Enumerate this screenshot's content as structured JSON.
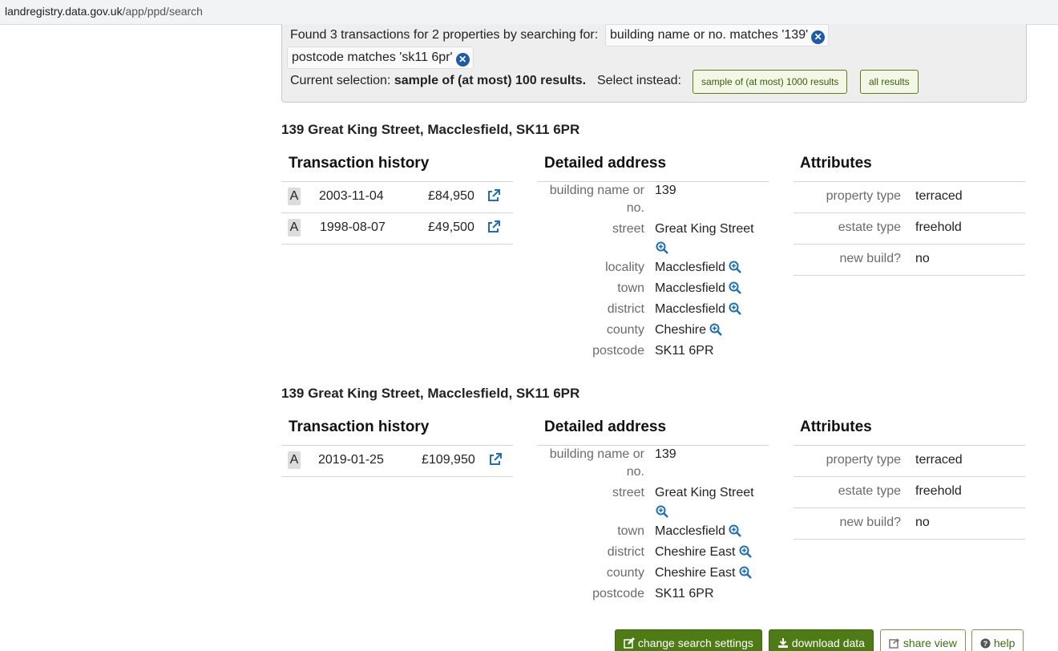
{
  "browser": {
    "url_host": "landregistry.data.gov.uk",
    "url_path": "/app/ppd/search"
  },
  "search": {
    "found_text": "Found 3 transactions for 2 properties by searching for:",
    "filters": [
      {
        "label": "building name or no. matches '139'"
      },
      {
        "label": "postcode matches 'sk11 6pr'"
      }
    ],
    "current_label": "Current selection:",
    "current_value": "sample of (at most) 100 results.",
    "select_instead": "Select instead:",
    "alt_sample": "sample of (at most) 1000 results",
    "alt_all": "all results"
  },
  "headings": {
    "transactions": "Transaction history",
    "address": "Detailed address",
    "attributes": "Attributes"
  },
  "properties": [
    {
      "title": "139 Great King Street, Macclesfield, SK11 6PR",
      "transactions": [
        {
          "badge": "A",
          "date": "2003-11-04",
          "price": "£84,950"
        },
        {
          "badge": "A",
          "date": "1998-08-07",
          "price": "£49,500"
        }
      ],
      "address": {
        "building_label_1": "building name or",
        "building_label_2": "no.",
        "building": "139",
        "street_label": "street",
        "street": "Great King Street",
        "locality_label": "locality",
        "locality": "Macclesfield",
        "town_label": "town",
        "town": "Macclesfield",
        "district_label": "district",
        "district": "Macclesfield",
        "county_label": "county",
        "county": "Cheshire",
        "postcode_label": "postcode",
        "postcode": "SK11 6PR"
      },
      "attributes": [
        {
          "label": "property type",
          "value": "terraced"
        },
        {
          "label": "estate type",
          "value": "freehold"
        },
        {
          "label": "new build?",
          "value": "no"
        }
      ]
    },
    {
      "title": "139 Great King Street, Macclesfield, SK11 6PR",
      "transactions": [
        {
          "badge": "A",
          "date": "2019-01-25",
          "price": "£109,950"
        }
      ],
      "address": {
        "building_label_1": "building name or",
        "building_label_2": "no.",
        "building": "139",
        "street_label": "street",
        "street": "Great King Street",
        "town_label": "town",
        "town": "Macclesfield",
        "district_label": "district",
        "district": "Cheshire East",
        "county_label": "county",
        "county": "Cheshire East",
        "postcode_label": "postcode",
        "postcode": "SK11 6PR"
      },
      "attributes": [
        {
          "label": "property type",
          "value": "terraced"
        },
        {
          "label": "estate type",
          "value": "freehold"
        },
        {
          "label": "new build?",
          "value": "no"
        }
      ]
    }
  ],
  "footer": {
    "change": "change search settings",
    "download": "download data",
    "share": "share view",
    "help": "help"
  },
  "colors": {
    "accent_green": "#4e7b16",
    "icon_blue": "#1f6fb2",
    "chip_close": "#1f5aa6"
  },
  "icons": {
    "external": "external-link-icon",
    "zoom": "zoom-in-icon",
    "close": "close-circle-icon"
  }
}
